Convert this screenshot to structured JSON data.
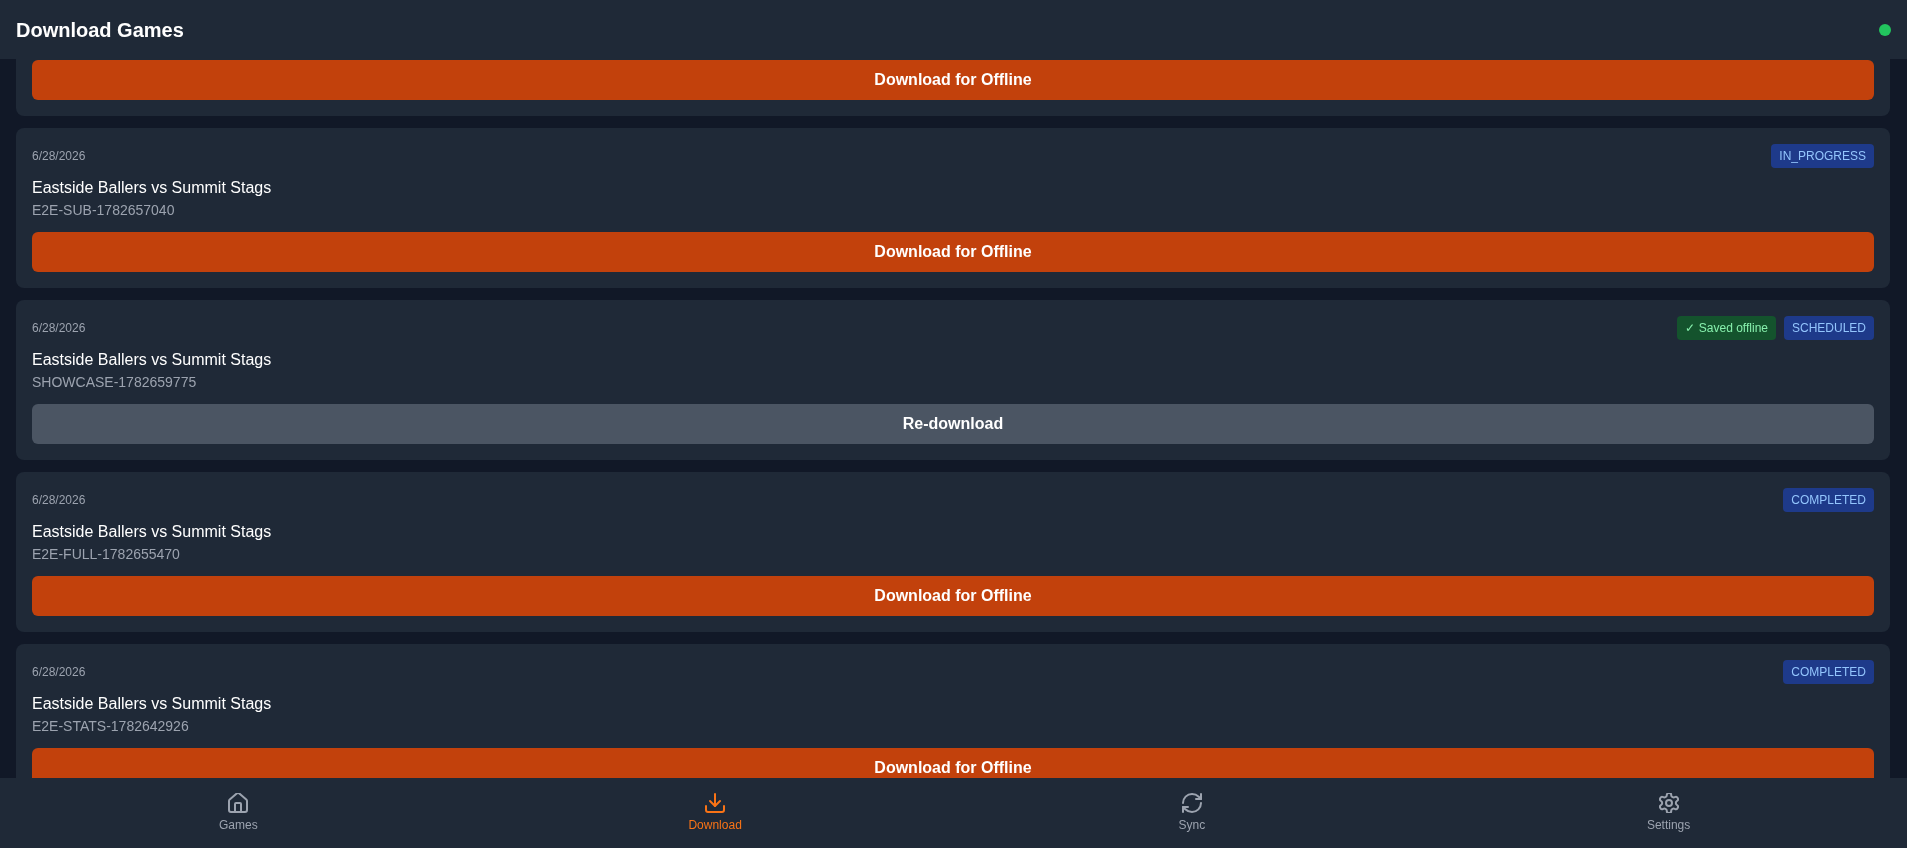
{
  "header": {
    "title": "Download Games",
    "online": true
  },
  "games": [
    {
      "button": {
        "kind": "download",
        "label": "Download for Offline"
      }
    },
    {
      "date": "6/28/2026",
      "title": "Eastside Ballers vs Summit Stags",
      "code": "E2E-SUB-1782657040",
      "badges": [
        {
          "kind": "status",
          "label": "IN_PROGRESS"
        }
      ],
      "button": {
        "kind": "download",
        "label": "Download for Offline"
      }
    },
    {
      "date": "6/28/2026",
      "title": "Eastside Ballers vs Summit Stags",
      "code": "SHOWCASE-1782659775",
      "badges": [
        {
          "kind": "saved",
          "label": "✓ Saved offline"
        },
        {
          "kind": "status",
          "label": "SCHEDULED"
        }
      ],
      "button": {
        "kind": "redownload",
        "label": "Re-download"
      }
    },
    {
      "date": "6/28/2026",
      "title": "Eastside Ballers vs Summit Stags",
      "code": "E2E-FULL-1782655470",
      "badges": [
        {
          "kind": "status",
          "label": "COMPLETED"
        }
      ],
      "button": {
        "kind": "download",
        "label": "Download for Offline"
      }
    },
    {
      "date": "6/28/2026",
      "title": "Eastside Ballers vs Summit Stags",
      "code": "E2E-STATS-1782642926",
      "badges": [
        {
          "kind": "status",
          "label": "COMPLETED"
        }
      ],
      "button": {
        "kind": "download",
        "label": "Download for Offline"
      }
    }
  ],
  "nav": [
    {
      "label": "Games",
      "selected": false
    },
    {
      "label": "Download",
      "selected": true
    },
    {
      "label": "Sync",
      "selected": false
    },
    {
      "label": "Settings",
      "selected": false
    }
  ]
}
